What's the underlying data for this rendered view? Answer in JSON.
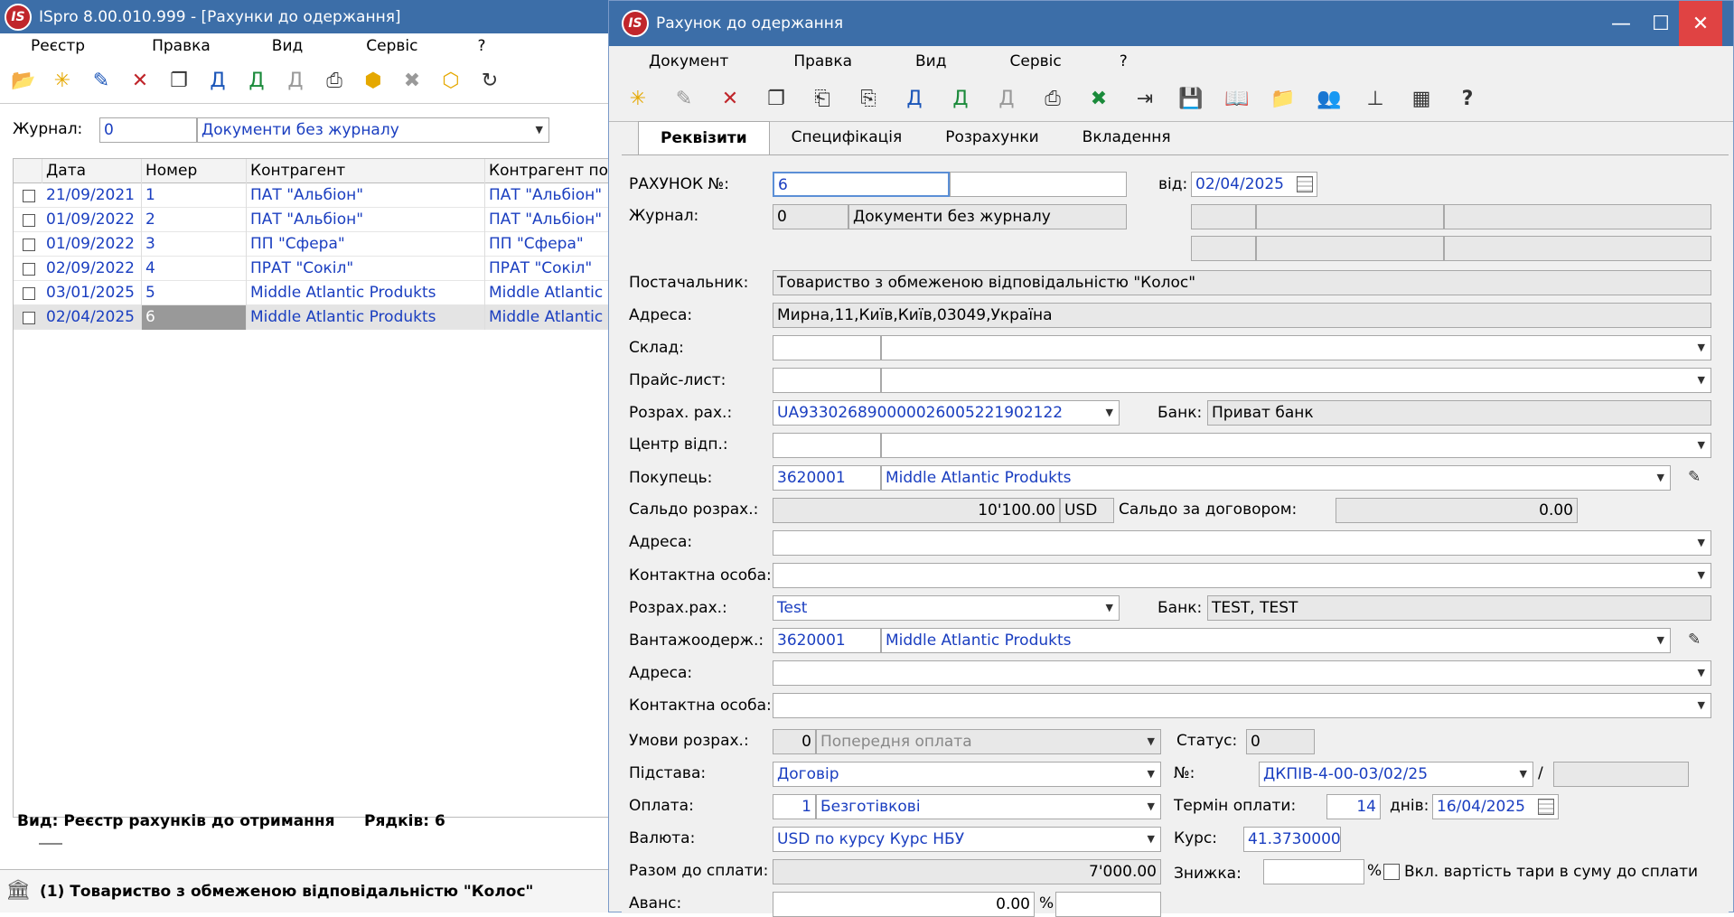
{
  "main": {
    "title": "ISpro 8.00.010.999 - [Рахунки до одержання]",
    "logo": "IS",
    "menu": [
      "Реєстр",
      "Правка",
      "Вид",
      "Сервіс",
      "?"
    ],
    "journal_label": "Журнал:",
    "journal_code": "0",
    "journal_name": "Документи без журналу",
    "columns": [
      "Дата",
      "Номер",
      "Контрагент",
      "Контрагент пов"
    ],
    "rows": [
      {
        "date": "21/09/2021",
        "num": "1",
        "contr": "ПАТ \"Альбіон\"",
        "contr2": "ПАТ \"Альбіон\""
      },
      {
        "date": "01/09/2022",
        "num": "2",
        "contr": "ПАТ \"Альбіон\"",
        "contr2": "ПАТ \"Альбіон\""
      },
      {
        "date": "01/09/2022",
        "num": "3",
        "contr": "ПП \"Сфера\"",
        "contr2": "ПП \"Сфера\""
      },
      {
        "date": "02/09/2022",
        "num": "4",
        "contr": "ПРАТ \"Сокіл\"",
        "contr2": "ПРАТ \"Сокіл\""
      },
      {
        "date": "03/01/2025",
        "num": "5",
        "contr": "Middle Atlantic Produkts",
        "contr2": "Middle Atlantic P"
      },
      {
        "date": "02/04/2025",
        "num": "6",
        "contr": "Middle Atlantic Produkts",
        "contr2": "Middle Atlantic P"
      }
    ],
    "status_view": "Вид: Реєстр рахунків до отримання",
    "status_rows": "Рядків: 6",
    "footer": "(1) Товариство з обмеженою відповідальністю \"Колос\""
  },
  "dlg": {
    "title": "Рахунок до одержання",
    "menu": [
      "Документ",
      "Правка",
      "Вид",
      "Сервіс",
      "?"
    ],
    "tabs": [
      "Реквізити",
      "Специфікація",
      "Розрахунки",
      "Вкладення"
    ],
    "invoice_label": "РАХУНОК №:",
    "invoice_no": "6",
    "from_label": "від:",
    "date": "02/04/2025",
    "journal_label": "Журнал:",
    "journal_code": "0",
    "journal_name": "Документи без журналу",
    "supplier_label": "Постачальник:",
    "supplier": "Товариство з обмеженою відповідальністю \"Колос\"",
    "address_label": "Адреса:",
    "address": "Мирна,11,Київ,Київ,03049,Україна",
    "warehouse_label": "Склад:",
    "pricelist_label": "Прайс-лист:",
    "account_label": "Розрах. рах.:",
    "account": "UA933026890000026005221902122",
    "bank_label": "Банк:",
    "bank": "Приват банк",
    "center_label": "Центр відп.:",
    "buyer_label": "Покупець:",
    "buyer_code": "3620001",
    "buyer_name": "Middle Atlantic Produkts",
    "saldo_label": "Сальдо розрах.:",
    "saldo": "10'100.00",
    "saldo_cur": "USD",
    "saldo_contract_label": "Сальдо за договором:",
    "saldo_contract": "0.00",
    "address2_label": "Адреса:",
    "contact_label": "Контактна особа:",
    "account2_label": "Розрах.рах.:",
    "account2": "Test",
    "bank2_label": "Банк:",
    "bank2": "TEST, TEST",
    "consignee_label": "Вантажоодерж.:",
    "consignee_code": "3620001",
    "consignee_name": "Middle Atlantic Produkts",
    "address3_label": "Адреса:",
    "contact2_label": "Контактна особа:",
    "terms_label": "Умови розрах.:",
    "terms_code": "0",
    "terms_name": "Попередня оплата",
    "status_label": "Статус:",
    "status": "0",
    "basis_label": "Підстава:",
    "basis": "Договір",
    "no_label": "№:",
    "contract_no": "ДКПІВ-4-00-03/02/25",
    "slash": "/",
    "payment_label": "Оплата:",
    "payment_code": "1",
    "payment_name": "Безготівкові",
    "due_label": "Термін оплати:",
    "due_days": "14",
    "days_label": "днів:",
    "due_date": "16/04/2025",
    "currency_label": "Валюта:",
    "currency": "USD по курсу Курс НБУ",
    "rate_label": "Курс:",
    "rate": "41.3730000",
    "total_label": "Разом до сплати:",
    "total": "7'000.00",
    "discount_label": "Знижка:",
    "percent": "%",
    "tare_label": "Вкл. вартість тари в суму до сплати",
    "advance_label": "Аванс:",
    "advance": "0.00",
    "percent2": "%"
  }
}
